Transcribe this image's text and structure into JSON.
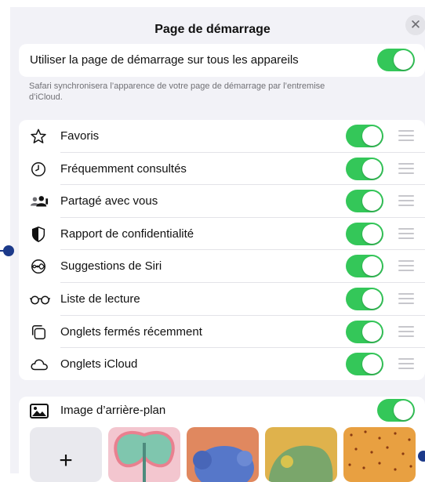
{
  "header": {
    "title": "Page de démarrage",
    "close_glyph": "✕"
  },
  "sync": {
    "label": "Utiliser la page de démarrage sur tous les appareils",
    "enabled": true,
    "footnote": "Safari synchronisera l’apparence de votre page de démarrage par l’entremise d’iCloud."
  },
  "sections": [
    {
      "label": "Favoris",
      "icon": "star-icon",
      "enabled": true
    },
    {
      "label": "Fréquemment consultés",
      "icon": "clock-icon",
      "enabled": true
    },
    {
      "label": "Partagé avec vous",
      "icon": "shared-people-icon",
      "enabled": true
    },
    {
      "label": "Rapport de confidentialité",
      "icon": "shield-icon",
      "enabled": true
    },
    {
      "label": "Suggestions de Siri",
      "icon": "siri-icon",
      "enabled": true
    },
    {
      "label": "Liste de lecture",
      "icon": "glasses-icon",
      "enabled": true
    },
    {
      "label": "Onglets fermés récemment",
      "icon": "closed-tabs-icon",
      "enabled": true
    },
    {
      "label": "Onglets iCloud",
      "icon": "cloud-icon",
      "enabled": true
    }
  ],
  "background": {
    "label": "Image d’arrière-plan",
    "enabled": true,
    "add_glyph": "+",
    "thumbnails": [
      "butterfly",
      "animal-orange",
      "turtle-yellow",
      "dots-orange"
    ]
  },
  "colors": {
    "toggle_on": "#34c759",
    "marker": "#1c3a8a"
  }
}
